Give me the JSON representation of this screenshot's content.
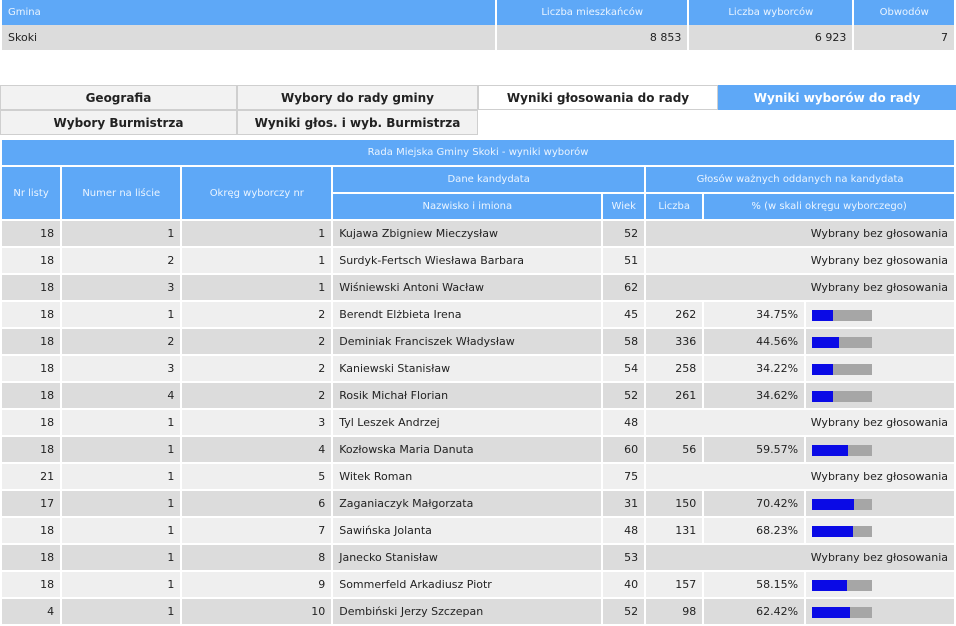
{
  "summary": {
    "headers": [
      "Gmina",
      "Liczba mieszkańców",
      "Liczba wyborców",
      "Obwodów"
    ],
    "row": [
      "Skoki",
      "8 853",
      "6 923",
      "7"
    ]
  },
  "tabs": [
    {
      "label": "Geografia"
    },
    {
      "label": "Wybory do rady gminy"
    },
    {
      "label": "Wyniki głosowania do rady"
    },
    {
      "label": "Wyniki wyborów do rady"
    },
    {
      "label": "Wybory Burmistrza"
    },
    {
      "label": "Wyniki głos. i wyb. Burmistrza"
    }
  ],
  "results": {
    "title": "Rada Miejska Gminy Skoki - wyniki wyborów",
    "col_nr_listy": "Nr listy",
    "col_numer": "Numer na liście",
    "col_okreg": "Okręg wyborczy nr",
    "group_dane": "Dane kandydata",
    "group_glosow": "Głosów ważnych oddanych na kandydata",
    "col_nazwisko": "Nazwisko i imiona",
    "col_wiek": "Wiek",
    "col_liczba": "Liczba",
    "col_procent": "% (w skali okręgu wyborczego)",
    "elected_text": "Wybrany bez głosowania",
    "rows": [
      {
        "lista": "18",
        "numer": "1",
        "okreg": "1",
        "name": "Kujawa Zbigniew Mieczysław",
        "wiek": "52",
        "liczba": "",
        "pct": "",
        "pct_value": null
      },
      {
        "lista": "18",
        "numer": "2",
        "okreg": "1",
        "name": "Surdyk-Fertsch Wiesława Barbara",
        "wiek": "51",
        "liczba": "",
        "pct": "",
        "pct_value": null
      },
      {
        "lista": "18",
        "numer": "3",
        "okreg": "1",
        "name": "Wiśniewski Antoni Wacław",
        "wiek": "62",
        "liczba": "",
        "pct": "",
        "pct_value": null
      },
      {
        "lista": "18",
        "numer": "1",
        "okreg": "2",
        "name": "Berendt Elżbieta Irena",
        "wiek": "45",
        "liczba": "262",
        "pct": "34.75%",
        "pct_value": 34.75
      },
      {
        "lista": "18",
        "numer": "2",
        "okreg": "2",
        "name": "Deminiak Franciszek Władysław",
        "wiek": "58",
        "liczba": "336",
        "pct": "44.56%",
        "pct_value": 44.56
      },
      {
        "lista": "18",
        "numer": "3",
        "okreg": "2",
        "name": "Kaniewski Stanisław",
        "wiek": "54",
        "liczba": "258",
        "pct": "34.22%",
        "pct_value": 34.22
      },
      {
        "lista": "18",
        "numer": "4",
        "okreg": "2",
        "name": "Rosik Michał Florian",
        "wiek": "52",
        "liczba": "261",
        "pct": "34.62%",
        "pct_value": 34.62
      },
      {
        "lista": "18",
        "numer": "1",
        "okreg": "3",
        "name": "Tyl Leszek Andrzej",
        "wiek": "48",
        "liczba": "",
        "pct": "",
        "pct_value": null
      },
      {
        "lista": "18",
        "numer": "1",
        "okreg": "4",
        "name": "Kozłowska Maria Danuta",
        "wiek": "60",
        "liczba": "56",
        "pct": "59.57%",
        "pct_value": 59.57
      },
      {
        "lista": "21",
        "numer": "1",
        "okreg": "5",
        "name": "Witek Roman",
        "wiek": "75",
        "liczba": "",
        "pct": "",
        "pct_value": null
      },
      {
        "lista": "17",
        "numer": "1",
        "okreg": "6",
        "name": "Zaganiaczyk Małgorzata",
        "wiek": "31",
        "liczba": "150",
        "pct": "70.42%",
        "pct_value": 70.42
      },
      {
        "lista": "18",
        "numer": "1",
        "okreg": "7",
        "name": "Sawińska Jolanta",
        "wiek": "48",
        "liczba": "131",
        "pct": "68.23%",
        "pct_value": 68.23
      },
      {
        "lista": "18",
        "numer": "1",
        "okreg": "8",
        "name": "Janecko Stanisław",
        "wiek": "53",
        "liczba": "",
        "pct": "",
        "pct_value": null
      },
      {
        "lista": "18",
        "numer": "1",
        "okreg": "9",
        "name": "Sommerfeld Arkadiusz Piotr",
        "wiek": "40",
        "liczba": "157",
        "pct": "58.15%",
        "pct_value": 58.15
      },
      {
        "lista": "4",
        "numer": "1",
        "okreg": "10",
        "name": "Dembiński Jerzy Szczepan",
        "wiek": "52",
        "liczba": "98",
        "pct": "62.42%",
        "pct_value": 62.42
      }
    ]
  }
}
